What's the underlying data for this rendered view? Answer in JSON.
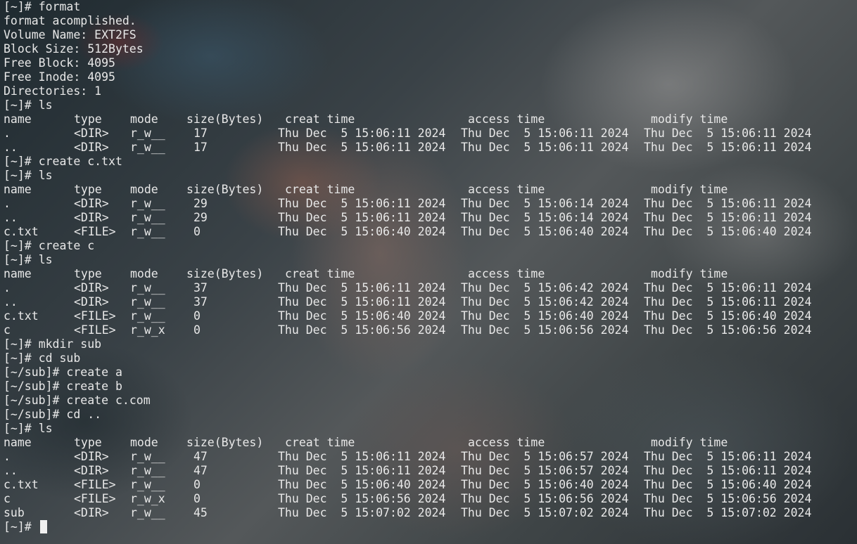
{
  "terminal": {
    "header": {
      "name": "name",
      "type": "type",
      "mode": "mode",
      "size": "size(Bytes)",
      "creat": "creat time",
      "access": "access time",
      "modify": "modify time"
    },
    "blocks": [
      {
        "kind": "text",
        "lines": [
          {
            "prompt": "[~]#",
            "cmd": "format"
          },
          {
            "text": "format acomplished."
          },
          {
            "text": "Volume Name: EXT2FS"
          },
          {
            "text": "Block Size: 512Bytes"
          },
          {
            "text": "Free Block: 4095"
          },
          {
            "text": "Free Inode: 4095"
          },
          {
            "text": "Directories: 1"
          },
          {
            "prompt": "[~]#",
            "cmd": "ls"
          }
        ]
      },
      {
        "kind": "table",
        "rows": [
          {
            "name": ".",
            "type": "<DIR>",
            "mode": "r_w__",
            "size": "17",
            "creat": "Thu Dec  5 15:06:11 2024",
            "access": "Thu Dec  5 15:06:11 2024",
            "modify": "Thu Dec  5 15:06:11 2024"
          },
          {
            "name": "..",
            "type": "<DIR>",
            "mode": "r_w__",
            "size": "17",
            "creat": "Thu Dec  5 15:06:11 2024",
            "access": "Thu Dec  5 15:06:11 2024",
            "modify": "Thu Dec  5 15:06:11 2024"
          }
        ]
      },
      {
        "kind": "text",
        "lines": [
          {
            "prompt": "[~]#",
            "cmd": "create c.txt"
          },
          {
            "prompt": "[~]#",
            "cmd": "ls"
          }
        ]
      },
      {
        "kind": "table",
        "rows": [
          {
            "name": ".",
            "type": "<DIR>",
            "mode": "r_w__",
            "size": "29",
            "creat": "Thu Dec  5 15:06:11 2024",
            "access": "Thu Dec  5 15:06:14 2024",
            "modify": "Thu Dec  5 15:06:11 2024"
          },
          {
            "name": "..",
            "type": "<DIR>",
            "mode": "r_w__",
            "size": "29",
            "creat": "Thu Dec  5 15:06:11 2024",
            "access": "Thu Dec  5 15:06:14 2024",
            "modify": "Thu Dec  5 15:06:11 2024"
          },
          {
            "name": "c.txt",
            "type": "<FILE>",
            "mode": "r_w__",
            "size": "0",
            "creat": "Thu Dec  5 15:06:40 2024",
            "access": "Thu Dec  5 15:06:40 2024",
            "modify": "Thu Dec  5 15:06:40 2024"
          }
        ]
      },
      {
        "kind": "text",
        "lines": [
          {
            "prompt": "[~]#",
            "cmd": "create c"
          },
          {
            "prompt": "[~]#",
            "cmd": "ls"
          }
        ]
      },
      {
        "kind": "table",
        "rows": [
          {
            "name": ".",
            "type": "<DIR>",
            "mode": "r_w__",
            "size": "37",
            "creat": "Thu Dec  5 15:06:11 2024",
            "access": "Thu Dec  5 15:06:42 2024",
            "modify": "Thu Dec  5 15:06:11 2024"
          },
          {
            "name": "..",
            "type": "<DIR>",
            "mode": "r_w__",
            "size": "37",
            "creat": "Thu Dec  5 15:06:11 2024",
            "access": "Thu Dec  5 15:06:42 2024",
            "modify": "Thu Dec  5 15:06:11 2024"
          },
          {
            "name": "c.txt",
            "type": "<FILE>",
            "mode": "r_w__",
            "size": "0",
            "creat": "Thu Dec  5 15:06:40 2024",
            "access": "Thu Dec  5 15:06:40 2024",
            "modify": "Thu Dec  5 15:06:40 2024"
          },
          {
            "name": "c",
            "type": "<FILE>",
            "mode": "r_w_x",
            "size": "0",
            "creat": "Thu Dec  5 15:06:56 2024",
            "access": "Thu Dec  5 15:06:56 2024",
            "modify": "Thu Dec  5 15:06:56 2024"
          }
        ]
      },
      {
        "kind": "text",
        "lines": [
          {
            "prompt": "[~]#",
            "cmd": "mkdir sub"
          },
          {
            "prompt": "[~]#",
            "cmd": "cd sub"
          },
          {
            "prompt": "[~/sub]#",
            "cmd": "create a"
          },
          {
            "prompt": "[~/sub]#",
            "cmd": "create b"
          },
          {
            "prompt": "[~/sub]#",
            "cmd": "create c.com"
          },
          {
            "prompt": "[~/sub]#",
            "cmd": "cd .."
          },
          {
            "prompt": "[~]#",
            "cmd": "ls"
          }
        ]
      },
      {
        "kind": "table",
        "rows": [
          {
            "name": ".",
            "type": "<DIR>",
            "mode": "r_w__",
            "size": "47",
            "creat": "Thu Dec  5 15:06:11 2024",
            "access": "Thu Dec  5 15:06:57 2024",
            "modify": "Thu Dec  5 15:06:11 2024"
          },
          {
            "name": "..",
            "type": "<DIR>",
            "mode": "r_w__",
            "size": "47",
            "creat": "Thu Dec  5 15:06:11 2024",
            "access": "Thu Dec  5 15:06:57 2024",
            "modify": "Thu Dec  5 15:06:11 2024"
          },
          {
            "name": "c.txt",
            "type": "<FILE>",
            "mode": "r_w__",
            "size": "0",
            "creat": "Thu Dec  5 15:06:40 2024",
            "access": "Thu Dec  5 15:06:40 2024",
            "modify": "Thu Dec  5 15:06:40 2024"
          },
          {
            "name": "c",
            "type": "<FILE>",
            "mode": "r_w_x",
            "size": "0",
            "creat": "Thu Dec  5 15:06:56 2024",
            "access": "Thu Dec  5 15:06:56 2024",
            "modify": "Thu Dec  5 15:06:56 2024"
          },
          {
            "name": "sub",
            "type": "<DIR>",
            "mode": "r_w__",
            "size": "45",
            "creat": "Thu Dec  5 15:07:02 2024",
            "access": "Thu Dec  5 15:07:02 2024",
            "modify": "Thu Dec  5 15:07:02 2024"
          }
        ]
      },
      {
        "kind": "input",
        "prompt": "[~]#"
      }
    ]
  }
}
